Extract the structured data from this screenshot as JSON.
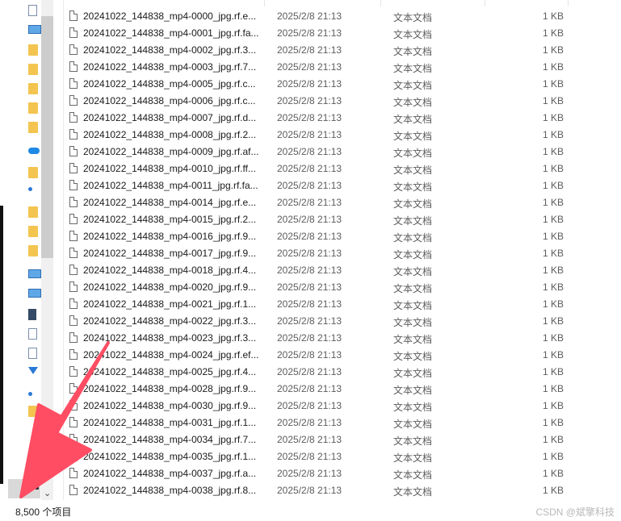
{
  "nav": {
    "icons": [
      "doc-icon",
      "pc-icon",
      "folder-icon",
      "folder-icon",
      "folder-icon",
      "folder-icon",
      "folder-icon",
      "cloud-icon",
      "folder-icon",
      "network-icon",
      "folder-icon",
      "folder-icon",
      "folder-icon",
      "pc-icon",
      "desktop-icon",
      "dark-icon",
      "doc-icon",
      "doc-icon",
      "download-icon",
      "dot-icon",
      "folder-icon"
    ]
  },
  "files": [
    {
      "name": "20241022_144838_mp4-0000_jpg.rf.e...",
      "date": "2025/2/8 21:13",
      "type": "文本文档",
      "size": "1 KB"
    },
    {
      "name": "20241022_144838_mp4-0001_jpg.rf.fa...",
      "date": "2025/2/8 21:13",
      "type": "文本文档",
      "size": "1 KB"
    },
    {
      "name": "20241022_144838_mp4-0002_jpg.rf.3...",
      "date": "2025/2/8 21:13",
      "type": "文本文档",
      "size": "1 KB"
    },
    {
      "name": "20241022_144838_mp4-0003_jpg.rf.7...",
      "date": "2025/2/8 21:13",
      "type": "文本文档",
      "size": "1 KB"
    },
    {
      "name": "20241022_144838_mp4-0005_jpg.rf.c...",
      "date": "2025/2/8 21:13",
      "type": "文本文档",
      "size": "1 KB"
    },
    {
      "name": "20241022_144838_mp4-0006_jpg.rf.c...",
      "date": "2025/2/8 21:13",
      "type": "文本文档",
      "size": "1 KB"
    },
    {
      "name": "20241022_144838_mp4-0007_jpg.rf.d...",
      "date": "2025/2/8 21:13",
      "type": "文本文档",
      "size": "1 KB"
    },
    {
      "name": "20241022_144838_mp4-0008_jpg.rf.2...",
      "date": "2025/2/8 21:13",
      "type": "文本文档",
      "size": "1 KB"
    },
    {
      "name": "20241022_144838_mp4-0009_jpg.rf.af...",
      "date": "2025/2/8 21:13",
      "type": "文本文档",
      "size": "1 KB"
    },
    {
      "name": "20241022_144838_mp4-0010_jpg.rf.ff...",
      "date": "2025/2/8 21:13",
      "type": "文本文档",
      "size": "1 KB"
    },
    {
      "name": "20241022_144838_mp4-0011_jpg.rf.fa...",
      "date": "2025/2/8 21:13",
      "type": "文本文档",
      "size": "1 KB"
    },
    {
      "name": "20241022_144838_mp4-0014_jpg.rf.e...",
      "date": "2025/2/8 21:13",
      "type": "文本文档",
      "size": "1 KB"
    },
    {
      "name": "20241022_144838_mp4-0015_jpg.rf.2...",
      "date": "2025/2/8 21:13",
      "type": "文本文档",
      "size": "1 KB"
    },
    {
      "name": "20241022_144838_mp4-0016_jpg.rf.9...",
      "date": "2025/2/8 21:13",
      "type": "文本文档",
      "size": "1 KB"
    },
    {
      "name": "20241022_144838_mp4-0017_jpg.rf.9...",
      "date": "2025/2/8 21:13",
      "type": "文本文档",
      "size": "1 KB"
    },
    {
      "name": "20241022_144838_mp4-0018_jpg.rf.4...",
      "date": "2025/2/8 21:13",
      "type": "文本文档",
      "size": "1 KB"
    },
    {
      "name": "20241022_144838_mp4-0020_jpg.rf.9...",
      "date": "2025/2/8 21:13",
      "type": "文本文档",
      "size": "1 KB"
    },
    {
      "name": "20241022_144838_mp4-0021_jpg.rf.1...",
      "date": "2025/2/8 21:13",
      "type": "文本文档",
      "size": "1 KB"
    },
    {
      "name": "20241022_144838_mp4-0022_jpg.rf.3...",
      "date": "2025/2/8 21:13",
      "type": "文本文档",
      "size": "1 KB"
    },
    {
      "name": "20241022_144838_mp4-0023_jpg.rf.3...",
      "date": "2025/2/8 21:13",
      "type": "文本文档",
      "size": "1 KB"
    },
    {
      "name": "20241022_144838_mp4-0024_jpg.rf.ef...",
      "date": "2025/2/8 21:13",
      "type": "文本文档",
      "size": "1 KB"
    },
    {
      "name": "20241022_144838_mp4-0025_jpg.rf.4...",
      "date": "2025/2/8 21:13",
      "type": "文本文档",
      "size": "1 KB"
    },
    {
      "name": "20241022_144838_mp4-0028_jpg.rf.9...",
      "date": "2025/2/8 21:13",
      "type": "文本文档",
      "size": "1 KB"
    },
    {
      "name": "20241022_144838_mp4-0030_jpg.rf.9...",
      "date": "2025/2/8 21:13",
      "type": "文本文档",
      "size": "1 KB"
    },
    {
      "name": "20241022_144838_mp4-0031_jpg.rf.1...",
      "date": "2025/2/8 21:13",
      "type": "文本文档",
      "size": "1 KB"
    },
    {
      "name": "20241022_144838_mp4-0034_jpg.rf.7...",
      "date": "2025/2/8 21:13",
      "type": "文本文档",
      "size": "1 KB"
    },
    {
      "name": "20241022_144838_mp4-0035_jpg.rf.1...",
      "date": "2025/2/8 21:13",
      "type": "文本文档",
      "size": "1 KB"
    },
    {
      "name": "20241022_144838_mp4-0037_jpg.rf.a...",
      "date": "2025/2/8 21:13",
      "type": "文本文档",
      "size": "1 KB"
    },
    {
      "name": "20241022_144838_mp4-0038_jpg.rf.8...",
      "date": "2025/2/8 21:13",
      "type": "文本文档",
      "size": "1 KB"
    }
  ],
  "status": {
    "item_count": "8,500 个项目",
    "watermark": "CSDN @斌擎科技"
  },
  "annotation": {
    "arrow_color": "#ff4d63",
    "arrow_icon": "annotation-arrow-icon"
  },
  "colors": {
    "folder": "#f3c44f",
    "accent": "#1e88e5"
  }
}
